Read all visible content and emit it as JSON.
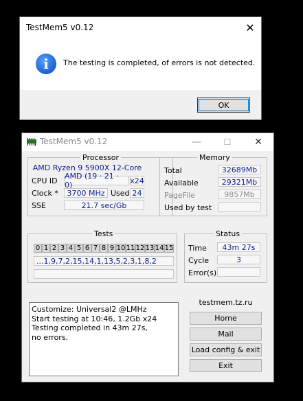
{
  "dialog": {
    "title": "TestMem5 v0.12",
    "message": "The testing is completed, of errors is not detected.",
    "ok_label": "OK",
    "close_glyph": "✕"
  },
  "window": {
    "title": "TestMem5 v0.12",
    "minimize_glyph": "—",
    "maximize_glyph": "☐",
    "close_glyph": "✕"
  },
  "processor": {
    "group_label": "Processor",
    "name": "AMD Ryzen 9 5900X 12-Core",
    "cpu_id_label": "CPU ID",
    "cpu_id_value": "AMD  (19 · 21 · 0)",
    "threads": "x24",
    "clock_label": "Clock *",
    "clock_value": "3700 MHz",
    "used_label": "Used",
    "used_value": "24",
    "sse_label": "SSE",
    "sse_value": "21.7 sec/Gb"
  },
  "memory": {
    "group_label": "Memory",
    "total_label": "Total",
    "total_value": "32689Mb",
    "available_label": "Available",
    "available_value": "29321Mb",
    "pagefile_label": "PageFile",
    "pagefile_value": "9857Mb",
    "used_by_test_label": "Used by test",
    "used_by_test_value": ""
  },
  "tests": {
    "group_label": "Tests",
    "cells": [
      "0",
      "1",
      "2",
      "3",
      "4",
      "5",
      "6",
      "7",
      "8",
      "9",
      "10",
      "11",
      "12",
      "13",
      "14",
      "15"
    ],
    "sequence": "...1,9,7,2,15,14,1,13,5,2,3,1,8,2",
    "progress": ""
  },
  "status": {
    "group_label": "Status",
    "time_label": "Time",
    "time_value": "43m 27s",
    "cycle_label": "Cycle",
    "cycle_value": "3",
    "errors_label": "Error(s)",
    "errors_value": ""
  },
  "log": {
    "lines": [
      "Customize: Universal2 @LMHz",
      "Start testing at 10:46, 1.2Gb x24",
      "Testing completed in 43m 27s,",
      "no errors."
    ]
  },
  "links": {
    "site": "testmem.tz.ru",
    "home_label": "Home",
    "mail_label": "Mail",
    "load_config_label": "Load config & exit",
    "exit_label": "Exit"
  }
}
